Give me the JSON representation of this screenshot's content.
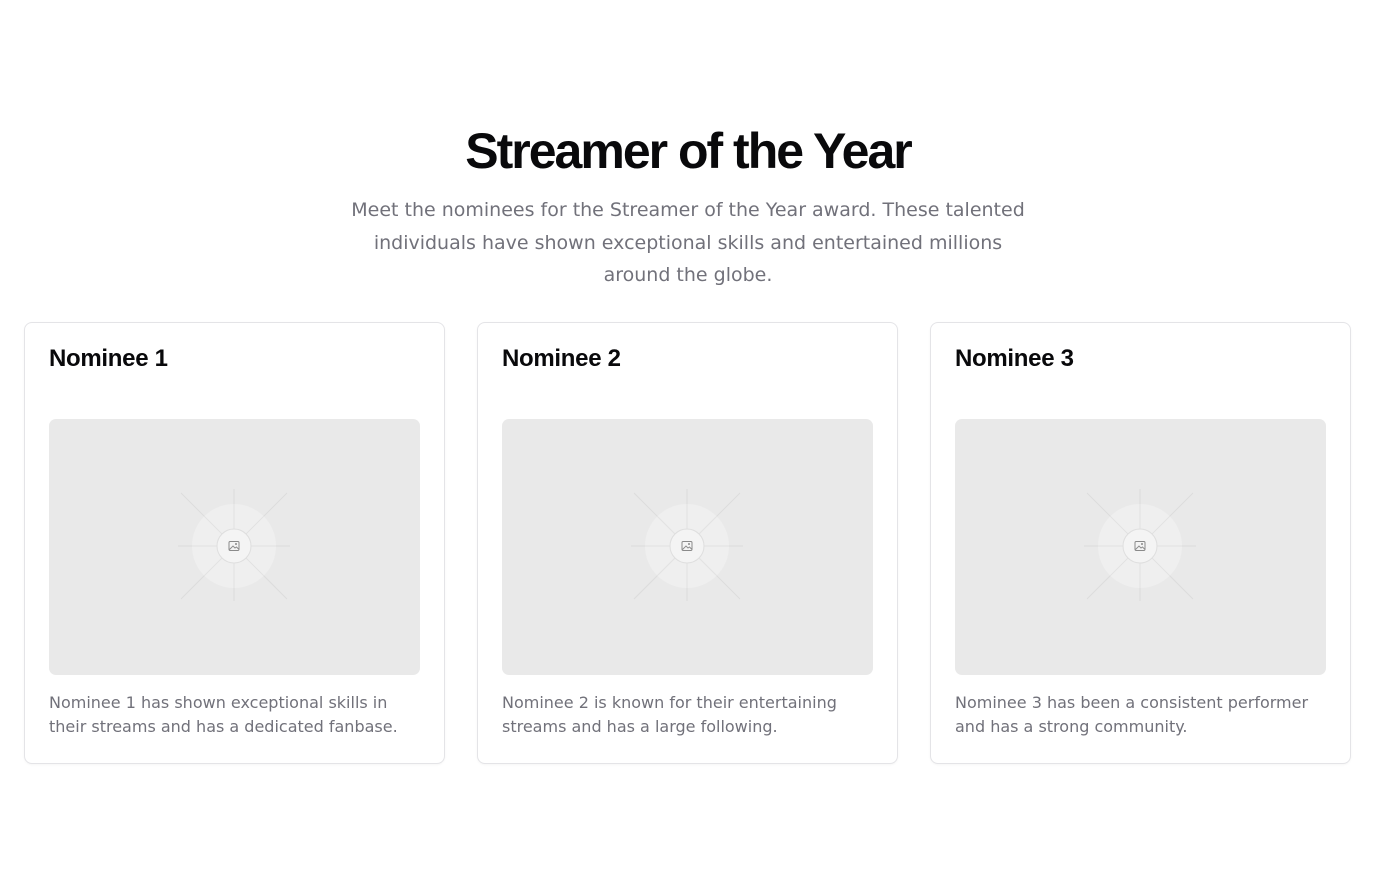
{
  "header": {
    "title": "Streamer of the Year",
    "subtitle": "Meet the nominees for the Streamer of the Year award. These talented individuals have shown exceptional skills and entertained millions around the globe."
  },
  "nominees": [
    {
      "name": "Nominee 1",
      "image_icon": "image-placeholder-icon",
      "description": "Nominee 1 has shown exceptional skills in their streams and has a dedicated fanbase."
    },
    {
      "name": "Nominee 2",
      "image_icon": "image-placeholder-icon",
      "description": "Nominee 2 is known for their entertaining streams and has a large following."
    },
    {
      "name": "Nominee 3",
      "image_icon": "image-placeholder-icon",
      "description": "Nominee 3 has been a consistent performer and has a strong community."
    }
  ],
  "colors": {
    "heading": "#09090b",
    "muted_text": "#71717a",
    "card_border": "#e4e4e7",
    "placeholder_bg": "#e9e9e9"
  }
}
